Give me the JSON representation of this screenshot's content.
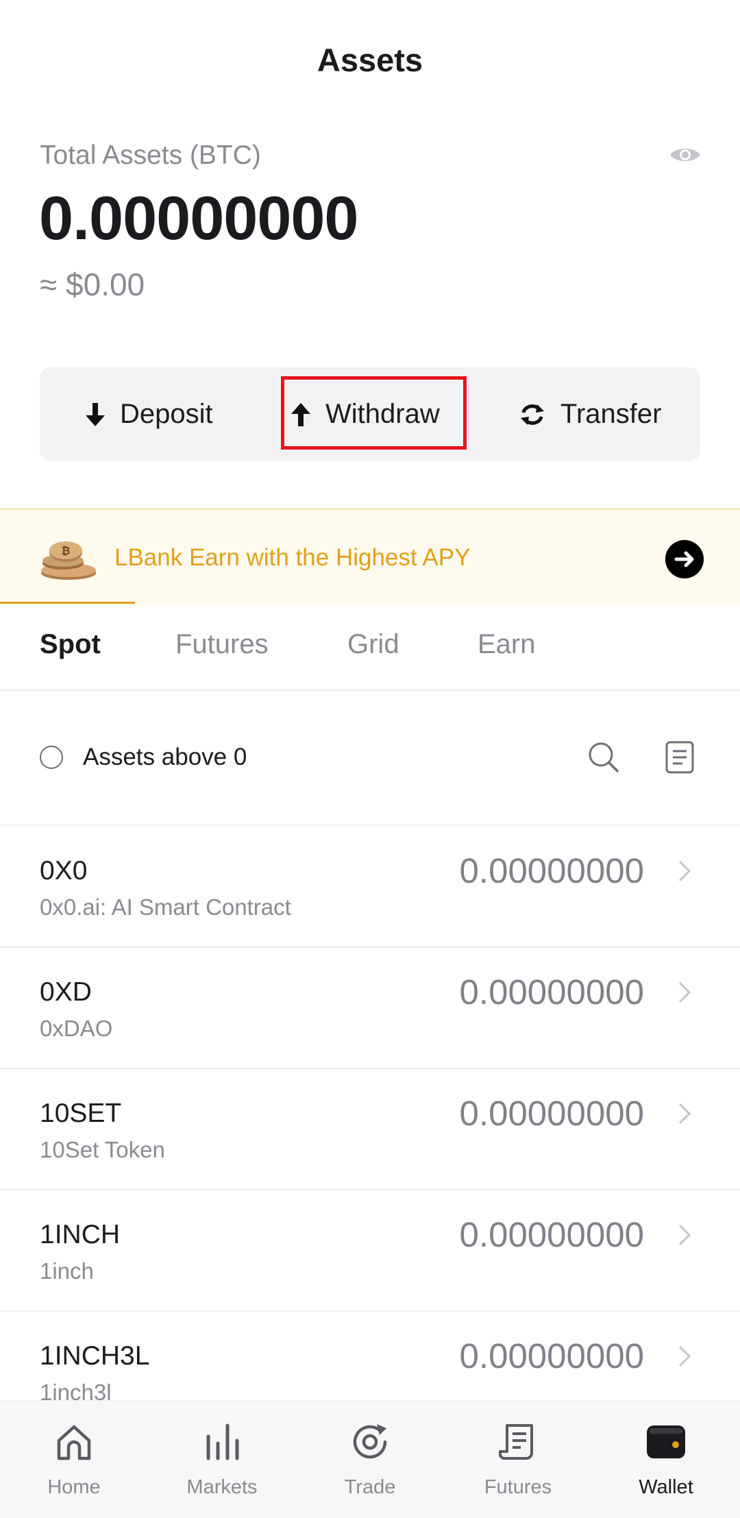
{
  "header": {
    "title": "Assets"
  },
  "summary": {
    "total_label": "Total Assets (BTC)",
    "total_value": "0.00000000",
    "usd_value": "≈ $0.00"
  },
  "actions": {
    "deposit": "Deposit",
    "withdraw": "Withdraw",
    "transfer": "Transfer"
  },
  "banner": {
    "text": "LBank Earn with the Highest APY"
  },
  "tabs": [
    {
      "label": "Spot",
      "active": true
    },
    {
      "label": "Futures",
      "active": false
    },
    {
      "label": "Grid",
      "active": false
    },
    {
      "label": "Earn",
      "active": false
    }
  ],
  "filter": {
    "label": "Assets above 0",
    "checked": false
  },
  "assets": [
    {
      "symbol": "0X0",
      "name": "0x0.ai: AI Smart Contract",
      "amount": "0.00000000"
    },
    {
      "symbol": "0XD",
      "name": "0xDAO",
      "amount": "0.00000000"
    },
    {
      "symbol": "10SET",
      "name": "10Set Token",
      "amount": "0.00000000"
    },
    {
      "symbol": "1INCH",
      "name": "1inch",
      "amount": "0.00000000"
    },
    {
      "symbol": "1INCH3L",
      "name": "1inch3l",
      "amount": "0.00000000"
    }
  ],
  "bottom_nav": [
    {
      "label": "Home",
      "icon": "home-icon",
      "active": false
    },
    {
      "label": "Markets",
      "icon": "markets-icon",
      "active": false
    },
    {
      "label": "Trade",
      "icon": "trade-icon",
      "active": false
    },
    {
      "label": "Futures",
      "icon": "futures-icon",
      "active": false
    },
    {
      "label": "Wallet",
      "icon": "wallet-icon",
      "active": true
    }
  ],
  "colors": {
    "accent": "#e0a01c",
    "highlight_box": "#e5141c",
    "muted_text": "#8a8a92"
  }
}
